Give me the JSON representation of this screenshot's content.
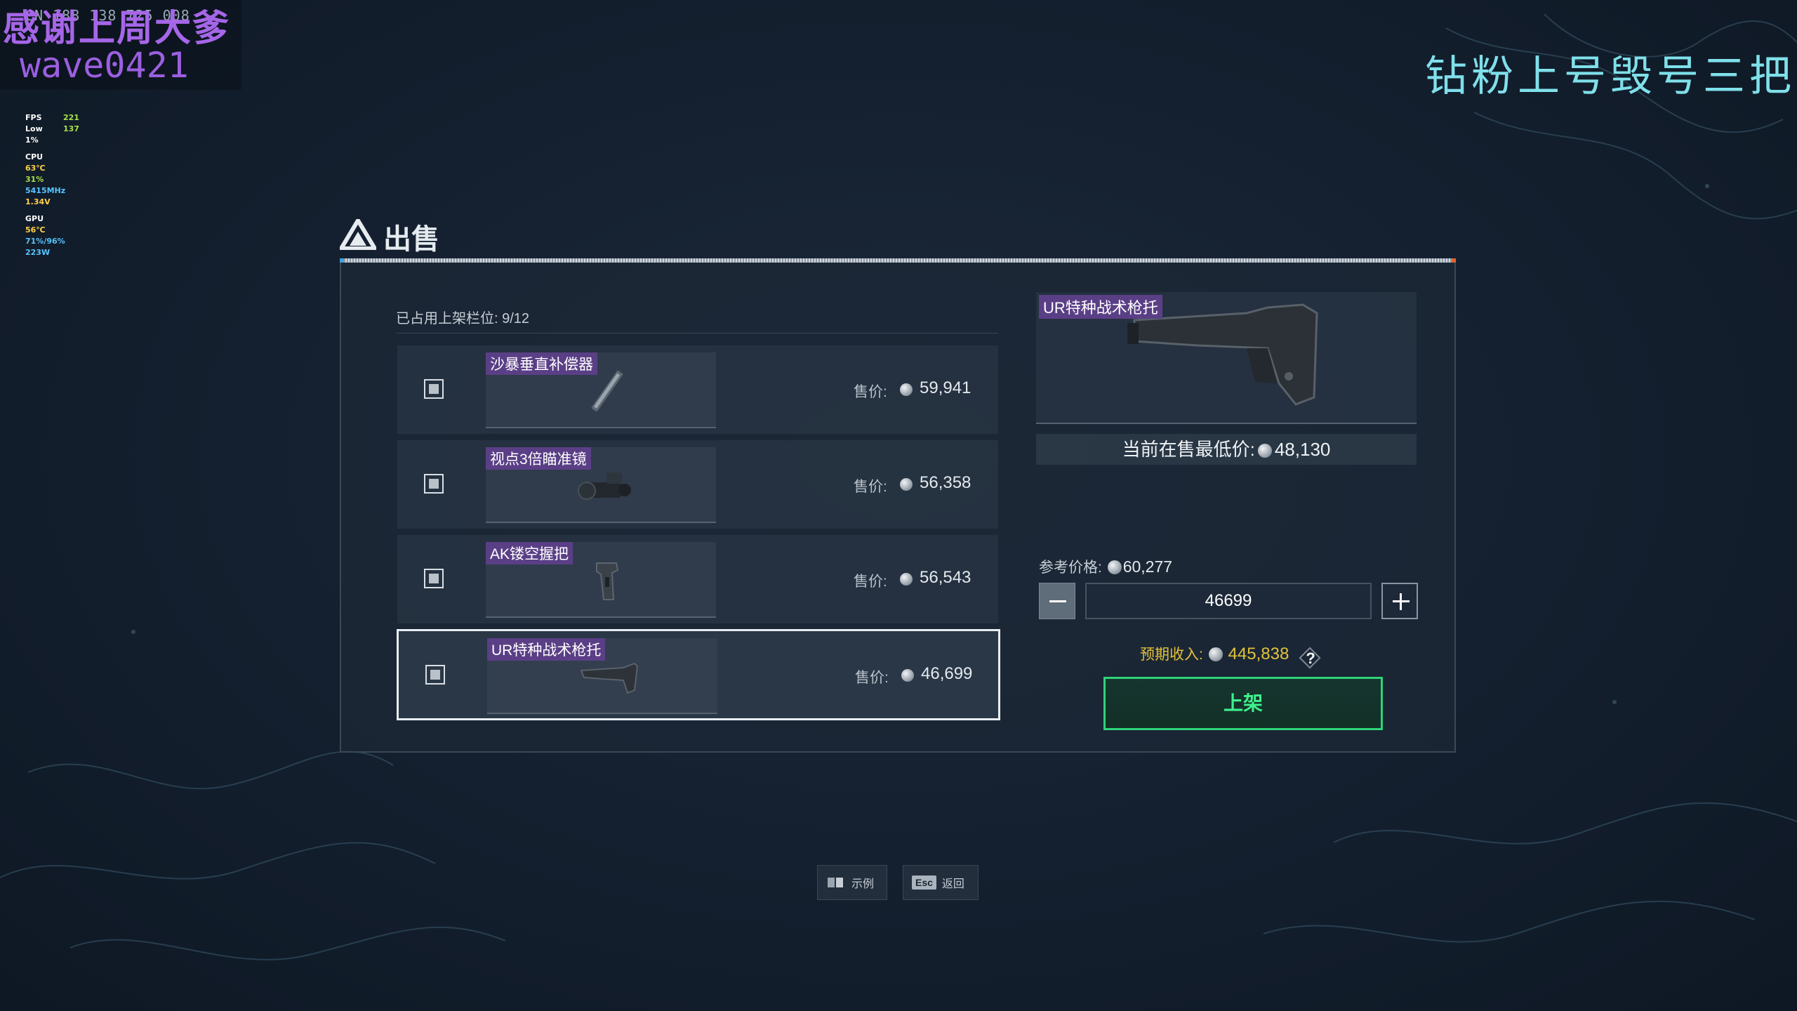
{
  "overlay": {
    "thanks": "感谢上周大爹",
    "small_text": "CN 188  138  725  008",
    "username": "wave0421",
    "stream_title": "钻粉上号毁号三把"
  },
  "perf": {
    "fps_label": "FPS",
    "fps": "221",
    "low_label": "Low 1%",
    "low": "137",
    "cpu_label": "CPU",
    "cpu_temp": "63℃",
    "cpu_load": "31%",
    "cpu_clock": "5415MHz",
    "cpu_volt": "1.34V",
    "gpu_label": "GPU",
    "gpu_temp": "56℃",
    "gpu_load": "71%/96%",
    "gpu_power": "223W"
  },
  "dialog": {
    "title": "出售",
    "slots_label": "已占用上架栏位: 9/12"
  },
  "items": [
    {
      "name": "沙暴垂直补偿器",
      "price_label": "售价:",
      "price": "59,941",
      "selected": false
    },
    {
      "name": "视点3倍瞄准镜",
      "price_label": "售价:",
      "price": "56,358",
      "selected": false
    },
    {
      "name": "AK镂空握把",
      "price_label": "售价:",
      "price": "56,543",
      "selected": false
    },
    {
      "name": "UR特种战术枪托",
      "price_label": "售价:",
      "price": "46,699",
      "selected": true
    }
  ],
  "detail": {
    "name": "UR特种战术枪托",
    "lowest_label": "当前在售最低价:",
    "lowest_price": "48,130",
    "ref_label": "参考价格:",
    "ref_price": "60,277",
    "quantity_value": "46699",
    "income_label": "预期收入:",
    "income_value": "445,838",
    "help": "?",
    "list_button": "上架"
  },
  "hints": {
    "example": "示例",
    "esc_key": "Esc",
    "back": "返回"
  },
  "colors": {
    "accent_green": "#2fd37a",
    "tag_purple": "#5a3f86",
    "income_yellow": "#e2c23a"
  }
}
